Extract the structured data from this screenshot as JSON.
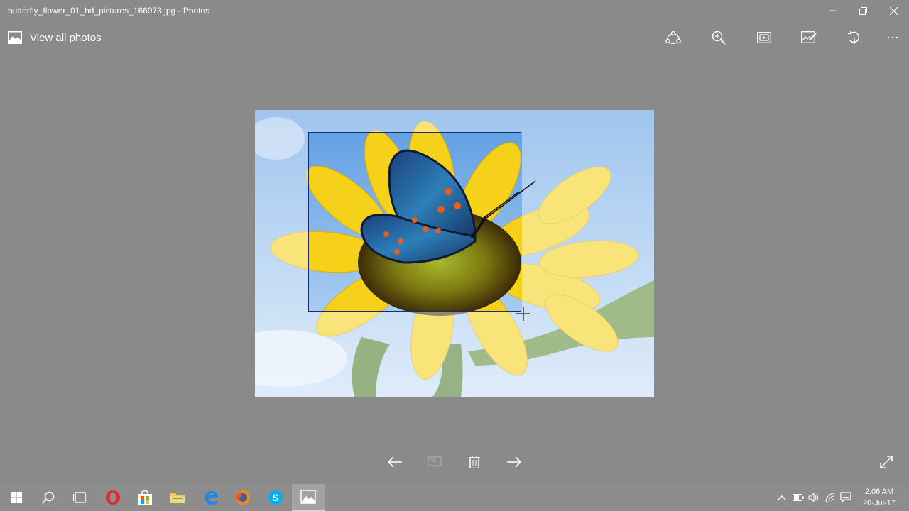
{
  "window": {
    "title": "butterfly_flower_01_hd_pictures_166973.jpg - Photos",
    "controls": [
      "minimize-icon",
      "restore-icon",
      "close-icon"
    ]
  },
  "appbar": {
    "view_all_label": "View all photos",
    "tools": [
      "share-icon",
      "zoom-icon",
      "slideshow-icon",
      "edit-icon",
      "rotate-icon",
      "more-icon"
    ]
  },
  "photo": {
    "subject": "butterfly on sunflower"
  },
  "bottom_bar": {
    "buttons": [
      "previous-icon",
      "draw-icon",
      "delete-icon",
      "next-icon",
      "fullscreen-icon"
    ]
  },
  "taskbar": {
    "apps": [
      "start-icon",
      "search-icon",
      "task-view-icon",
      "opera-icon",
      "store-icon",
      "file-explorer-icon",
      "edge-icon",
      "firefox-icon",
      "skype-icon",
      "photos-icon"
    ],
    "tray_icons": [
      "chevron-up-icon",
      "battery-icon",
      "volume-icon",
      "wifi-icon",
      "notifications-icon"
    ],
    "clock_time": "2:06 AM",
    "clock_date": "20-Jul-17"
  },
  "colors": {
    "background": "#8a8a8a",
    "taskbar": "#8d8d8d",
    "selection_border": "#1a2a6b"
  }
}
